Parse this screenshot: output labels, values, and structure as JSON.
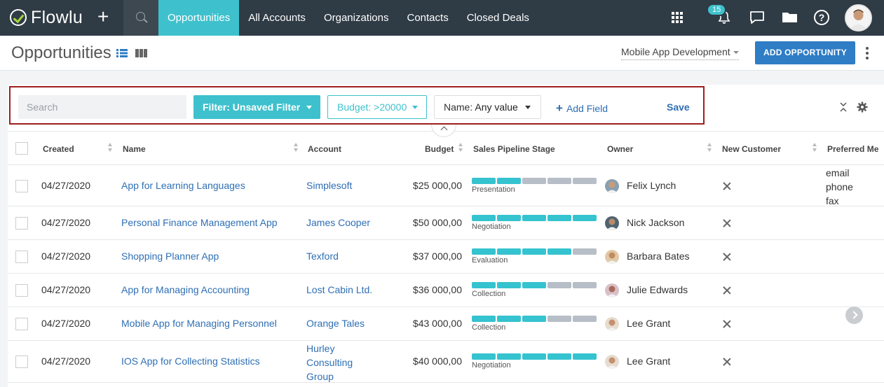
{
  "app": {
    "name": "Flowlu"
  },
  "nav": {
    "items": [
      {
        "label": "Opportunities",
        "active": true
      },
      {
        "label": "All Accounts",
        "active": false
      },
      {
        "label": "Organizations",
        "active": false
      },
      {
        "label": "Contacts",
        "active": false
      },
      {
        "label": "Closed Deals",
        "active": false
      }
    ],
    "notifications_count": "15"
  },
  "page": {
    "title": "Opportunities",
    "pipeline": "Mobile App Development",
    "add_button": "ADD OPPORTUNITY"
  },
  "filters": {
    "search_placeholder": "Search",
    "filter_label": "Filter: Unsaved Filter",
    "budget_label": "Budget: >20000",
    "name_key": "Name:",
    "name_value": "Any value",
    "add_field": "Add Field",
    "save": "Save"
  },
  "table": {
    "columns": [
      "Created",
      "Name",
      "Account",
      "Budget",
      "Sales Pipeline Stage",
      "Owner",
      "New Customer",
      "Preferred Me"
    ],
    "rows": [
      {
        "created": "04/27/2020",
        "name": "App for Learning Languages",
        "account": "Simplesoft",
        "budget": "$25 000,00",
        "stage": "Presentation",
        "progress": 2,
        "owner": "Felix Lynch",
        "preferred": [
          "email",
          "phone",
          "fax"
        ]
      },
      {
        "created": "04/27/2020",
        "name": "Personal Finance Management App",
        "account": "James Cooper",
        "budget": "$50 000,00",
        "stage": "Negotiation",
        "progress": 5,
        "owner": "Nick Jackson",
        "preferred": []
      },
      {
        "created": "04/27/2020",
        "name": "Shopping Planner App",
        "account": "Texford",
        "budget": "$37 000,00",
        "stage": "Evaluation",
        "progress": 4,
        "owner": "Barbara Bates",
        "preferred": []
      },
      {
        "created": "04/27/2020",
        "name": "App for Managing Accounting",
        "account": "Lost Cabin Ltd.",
        "budget": "$36 000,00",
        "stage": "Collection",
        "progress": 3,
        "owner": "Julie Edwards",
        "preferred": []
      },
      {
        "created": "04/27/2020",
        "name": "Mobile App for Managing Personnel",
        "account": "Orange Tales",
        "budget": "$43 000,00",
        "stage": "Collection",
        "progress": 3,
        "owner": "Lee Grant",
        "preferred": []
      },
      {
        "created": "04/27/2020",
        "name": "IOS App for Collecting Statistics",
        "account": "Hurley Consulting Group",
        "budget": "$40 000,00",
        "stage": "Negotiation",
        "progress": 5,
        "owner": "Lee Grant",
        "preferred": []
      }
    ]
  },
  "colors": {
    "accent": "#3ec1cd",
    "brand_dark": "#2f3b45",
    "primary": "#2e7dc5",
    "link": "#2e6fb5"
  }
}
